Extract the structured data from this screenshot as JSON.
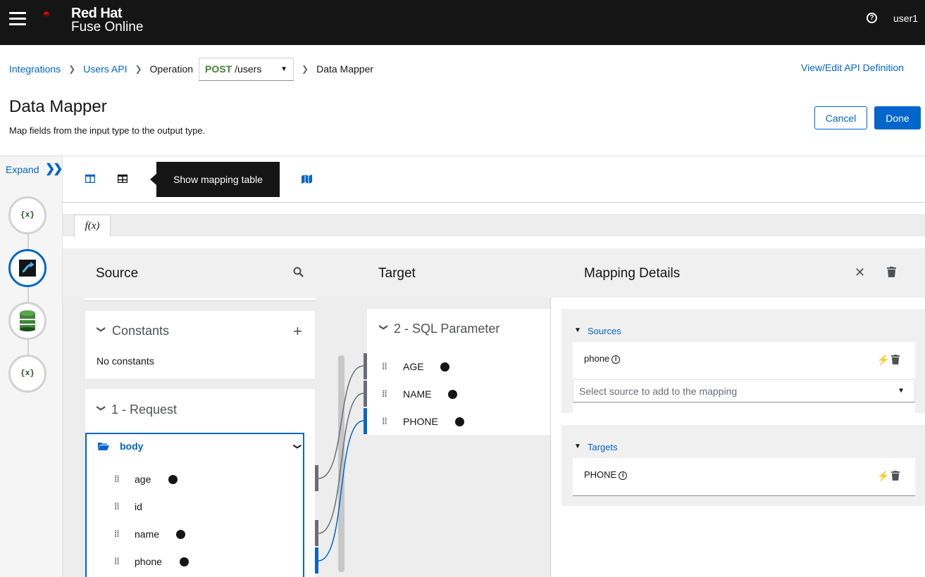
{
  "masthead": {
    "brand_line1": "Red Hat",
    "brand_line2": "Fuse Online",
    "help_icon": "question-circle-icon",
    "user": "user1"
  },
  "breadcrumb": {
    "items": [
      "Integrations",
      "Users API",
      "Operation"
    ],
    "operation_method": "POST",
    "operation_path": "/users",
    "current": "Data Mapper",
    "view_edit": "View/Edit API Definition"
  },
  "page": {
    "title": "Data Mapper",
    "subtitle": "Map fields from the input type to the output type.",
    "cancel": "Cancel",
    "done": "Done"
  },
  "sidebar": {
    "expand": "Expand",
    "steps": [
      "{x}",
      "api-mapper-icon",
      "database-icon",
      "{x}"
    ]
  },
  "toolbar": {
    "tooltip": "Show mapping table",
    "fx_tab": "f(x)"
  },
  "source": {
    "title": "Source",
    "constants_title": "Constants",
    "constants_empty": "No constants",
    "request_title": "1 - Request",
    "body_label": "body",
    "fields": [
      "age",
      "id",
      "name",
      "phone"
    ]
  },
  "target": {
    "title": "Target",
    "param_title": "2 - SQL Parameter",
    "fields": [
      "AGE",
      "NAME",
      "PHONE"
    ]
  },
  "details": {
    "title": "Mapping Details",
    "sources_label": "Sources",
    "source_field": "phone",
    "select_placeholder": "Select source to add to the mapping",
    "targets_label": "Targets",
    "target_field": "PHONE"
  },
  "colors": {
    "accent": "#0066cc",
    "post": "#3e8635",
    "masthead": "#151515",
    "brand_red": "#ee0000"
  }
}
